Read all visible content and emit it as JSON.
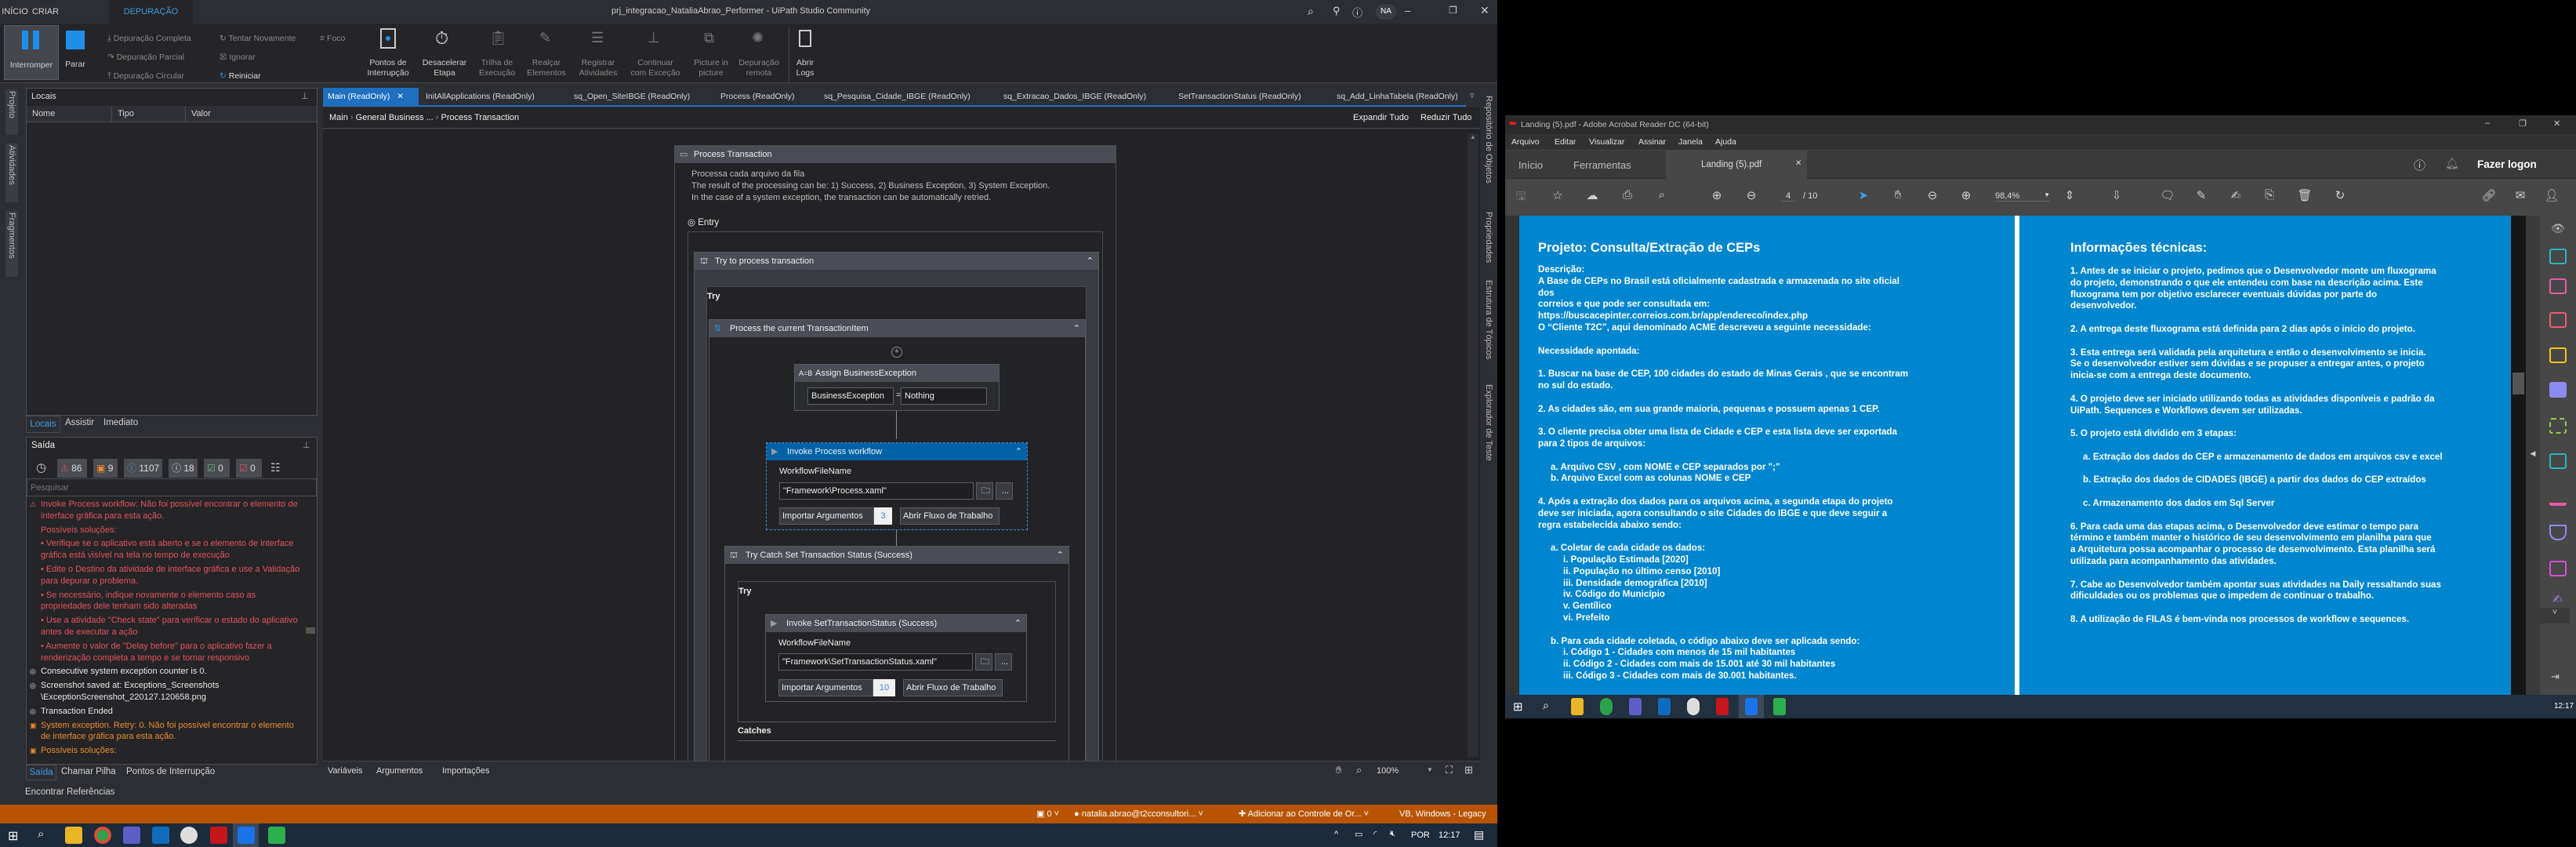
{
  "uipath": {
    "ribbon_tabs": [
      "INÍCIO",
      "CRIAR",
      "DEPURAÇÃO"
    ],
    "window_title": "prj_integracao_NataliaAbrao_Performer - UiPath Studio Community",
    "user_initials": "NA",
    "ribbon": {
      "interromper": "Interromper",
      "parar": "Parar",
      "depuracao_completa": "Depuração Completa",
      "depuracao_parcial": "Depuração Parcial",
      "depuracao_circular": "Depuração Circular",
      "tentar_novamente": "Tentar Novamente",
      "ignorar": "Ignorar",
      "reiniciar": "Reiniciar",
      "foco": "Foco",
      "pontos": [
        "Pontos de",
        "Interrupção"
      ],
      "desacelerar": [
        "Desacelerar",
        "Etapa"
      ],
      "trilha": [
        "Trilha de",
        "Execução"
      ],
      "realcar": [
        "Realçar",
        "Elementos"
      ],
      "registrar": [
        "Registrar",
        "Atividades"
      ],
      "continuar": [
        "Continuar",
        "com Exceção"
      ],
      "picture": [
        "Picture in",
        "picture"
      ],
      "remota": [
        "Depuração",
        "remota"
      ],
      "logs": [
        "Abrir",
        "Logs"
      ]
    },
    "left_strip": [
      "Projeto",
      "Atividades",
      "Fragmentos"
    ],
    "locals": {
      "title": "Locais",
      "columns": [
        "Nome",
        "Tipo",
        "Valor"
      ],
      "tabs": [
        "Locais",
        "Assistir",
        "Imediato"
      ]
    },
    "output": {
      "title": "Saída",
      "filters": {
        "errors": "86",
        "warnings": "9",
        "info": "1107",
        "trace": "18",
        "success": "0",
        "failed": "0"
      },
      "search_placeholder": "Pesquisar",
      "messages": [
        {
          "level": "e",
          "text": "Invoke Process workflow: Não foi possível encontrar o elemento de interface gráfica para esta ação."
        },
        {
          "level": "b",
          "text": "Possíveis soluções:"
        },
        {
          "level": "b",
          "text": "  •  Verifique se o aplicativo está aberto e se o elemento de interface gráfica está visível na tela no tempo de execução"
        },
        {
          "level": "b",
          "text": "  •  Edite o Destino da atividade de interface gráfica e use a Validação para depurar o problema."
        },
        {
          "level": "b",
          "text": "  •  Se necessário, indique novamente o elemento caso as propriedades dele tenham sido alteradas"
        },
        {
          "level": "b",
          "text": "  •  Use a atividade \"Check state\" para verificar o estado do aplicativo antes de executar a ação"
        },
        {
          "level": "b",
          "text": "  •  Aumente o valor de \"Delay before\" para o aplicativo fazer a renderização completa a tempo e se tornar responsivo"
        },
        {
          "level": "i",
          "text": "Consecutive system exception counter is 0."
        },
        {
          "level": "i",
          "text": "Screenshot saved at: Exceptions_Screenshots \\ExceptionScreenshot_220127.120658.png"
        },
        {
          "level": "i",
          "text": "Transaction Ended"
        },
        {
          "level": "w",
          "text": "System exception. Retry: 0. Não foi possível encontrar o elemento de interface gráfica para esta ação."
        },
        {
          "level": "w",
          "text": "Possíveis soluções:"
        }
      ],
      "bottom_tabs": [
        "Saída",
        "Chamar Pilha",
        "Pontos de Interrupção"
      ],
      "find_refs": "Encontrar Referências"
    },
    "doc_tabs": [
      "Main (ReadOnly)",
      "InitAllApplications (ReadOnly)",
      "sq_Open_SiteIBGE (ReadOnly)",
      "Process (ReadOnly)",
      "sq_Pesquisa_Cidade_IBGE (ReadOnly)",
      "sq_Extracao_Dados_IBGE (ReadOnly)",
      "SetTransactionStatus (ReadOnly)",
      "sq_Add_LinhaTabela (ReadOnly)"
    ],
    "breadcrumb": [
      "Main",
      "General Business ...",
      "Process Transaction"
    ],
    "expand_all": "Expandir Tudo",
    "collapse_all": "Reduzir Tudo",
    "designer": {
      "process_title": "Process Transaction",
      "description": [
        "Processa cada arquivo da fila",
        "The result of the processing can be: 1) Success, 2) Business Exception, 3) System Exception.",
        "In the case of a system exception, the transaction can be automatically retried."
      ],
      "entry": "Entry",
      "try_process": "Try to process transaction",
      "try_label": "Try",
      "process_item": "Process the current TransactionItem",
      "assign_title": "Assign BusinessException",
      "assign_to": "BusinessException",
      "assign_value": "Nothing",
      "invoke1": {
        "title": "Invoke Process workflow",
        "label": "WorkflowFileName",
        "file": "\"Framework\\Process.xaml\"",
        "import": "Importar Argumentos",
        "count": "3",
        "open": "Abrir Fluxo de Trabalho"
      },
      "trycatch_title": "Try Catch Set Transaction Status (Success)",
      "invoke2": {
        "title": "Invoke SetTransactionStatus (Success)",
        "label": "WorkflowFileName",
        "file": "\"Framework\\SetTransactionStatus.xaml\"",
        "import": "Importar Argumentos",
        "count": "10",
        "open": "Abrir Fluxo de Trabalho"
      },
      "catches": "Catches"
    },
    "bottom_bar": [
      "Variáveis",
      "Argumentos",
      "Importações"
    ],
    "zoom": "100%",
    "right_panels": [
      "Repositório de Objetos",
      "Propriedades",
      "Estrutura de Tópicos",
      "Explorador de Teste"
    ],
    "status": {
      "git": "0",
      "user": "natalia.abrao@t2cconsultori...",
      "source_control": "Adicionar ao Controle de Or...",
      "lang": "VB, Windows - Legacy"
    },
    "tray": {
      "lang": "POR",
      "time": "12:17"
    }
  },
  "acrobat": {
    "window_title": "Landing (5).pdf - Adobe Acrobat Reader DC (64-bit)",
    "menu": [
      "Arquivo",
      "Editar",
      "Visualizar",
      "Assinar",
      "Janela",
      "Ajuda"
    ],
    "tabs": [
      "Início",
      "Ferramentas",
      "Landing (5).pdf"
    ],
    "sign_in": "Fazer logon",
    "page_current": "4",
    "page_total": "/ 10",
    "zoom": "98,4%",
    "left_title": "Projeto: Consulta/Extração de CEPs",
    "left_lines": [
      {
        "t": "Descrição:",
        "l": 0
      },
      {
        "t": "A Base de CEPs no Brasil está oficialmente cadastrada e armazenada no site oficial",
        "l": 0
      },
      {
        "t": "dos",
        "l": 0
      },
      {
        "t": "correios e que pode ser consultada em:",
        "l": 0
      },
      {
        "t": "https://buscacepinter.correios.com.br/app/endereco/index.php",
        "l": 0
      },
      {
        "t": "O “Cliente T2C”, aqui denominado ACME descreveu a seguinte necessidade:",
        "l": 0
      },
      {
        "t": "",
        "l": 0
      },
      {
        "t": "Necessidade apontada:",
        "l": 0
      },
      {
        "t": "",
        "l": 0
      },
      {
        "t": "1. Buscar na base de CEP, 100 cidades do estado de Minas Gerais , que se encontram",
        "l": 0
      },
      {
        "t": "no sul do estado.",
        "l": 0
      },
      {
        "t": "",
        "l": 0
      },
      {
        "t": "2. As cidades são, em sua grande maioria, pequenas e possuem apenas 1 CEP.",
        "l": 0
      },
      {
        "t": "",
        "l": 0
      },
      {
        "t": "3. O cliente precisa obter uma lista de Cidade e CEP e esta lista deve ser exportada",
        "l": 0
      },
      {
        "t": "para 2 tipos de arquivos:",
        "l": 0
      },
      {
        "t": "",
        "l": 0
      },
      {
        "t": "a. Arquivo CSV , com NOME e CEP separados por \";\"",
        "l": 1
      },
      {
        "t": "b. Arquivo Excel com as colunas NOME e CEP",
        "l": 1
      },
      {
        "t": "",
        "l": 0
      },
      {
        "t": "4. Após a extração dos dados para os arquivos acima, a segunda etapa do projeto",
        "l": 0
      },
      {
        "t": "deve ser iniciada, agora consultando o site Cidades do IBGE e que deve seguir a",
        "l": 0
      },
      {
        "t": "regra estabelecida abaixo sendo:",
        "l": 0
      },
      {
        "t": "",
        "l": 0
      },
      {
        "t": "a. Coletar de cada cidade os dados:",
        "l": 1
      },
      {
        "t": "i. População Estimada [2020]",
        "l": 2
      },
      {
        "t": "ii. População no último censo [2010]",
        "l": 2
      },
      {
        "t": "iii. Densidade demográfica [2010]",
        "l": 2
      },
      {
        "t": "iv. Código do Município",
        "l": 2
      },
      {
        "t": "v. Gentílico",
        "l": 2
      },
      {
        "t": "vi. Prefeito",
        "l": 2
      },
      {
        "t": "",
        "l": 0
      },
      {
        "t": "b. Para cada cidade coletada, o código abaixo deve ser aplicada sendo:",
        "l": 1
      },
      {
        "t": "i. Código 1 - Cidades com menos de 15 mil habitantes",
        "l": 2
      },
      {
        "t": "ii. Código 2 - Cidades com mais de 15.001 até 30 mil habitantes",
        "l": 2
      },
      {
        "t": "iii. Código 3 - Cidades com mais de 30.001 habitantes.",
        "l": 2
      }
    ],
    "right_title": "Informações técnicas:",
    "right_lines": [
      {
        "t": "1. Antes de se iniciar o projeto, pedimos que o Desenvolvedor monte um fluxograma",
        "l": 0
      },
      {
        "t": "do projeto, demonstrando o que ele entendeu com base na descrição acima. Este",
        "l": 0
      },
      {
        "t": "fluxograma tem por objetivo esclarecer eventuais dúvidas por parte do",
        "l": 0
      },
      {
        "t": "desenvolvedor.",
        "l": 0
      },
      {
        "t": "",
        "l": 0
      },
      {
        "t": "2. A entrega deste fluxograma está definida para 2 dias após o início do projeto.",
        "l": 0
      },
      {
        "t": "",
        "l": 0
      },
      {
        "t": "3. Esta entrega será validada pela arquitetura e então o desenvolvimento se inicia.",
        "l": 0
      },
      {
        "t": "Se o desenvolvedor estiver sem dúvidas e se propuser a entregar antes, o projeto",
        "l": 0
      },
      {
        "t": "inicia-se com a entrega deste documento.",
        "l": 0
      },
      {
        "t": "",
        "l": 0
      },
      {
        "t": "4. O projeto deve ser iniciado utilizando todas as atividades disponíveis e padrão da",
        "l": 0
      },
      {
        "t": "UiPath. Sequences e Workflows devem ser utilizadas.",
        "l": 0
      },
      {
        "t": "",
        "l": 0
      },
      {
        "t": "5. O projeto está dividido em 3 etapas:",
        "l": 0
      },
      {
        "t": "",
        "l": 0
      },
      {
        "t": "a. Extração dos dados do CEP e armazenamento de dados em arquivos csv e excel",
        "l": 1
      },
      {
        "t": "",
        "l": 0
      },
      {
        "t": "b. Extração dos dados de CIDADES (IBGE) a partir dos dados do CEP extraídos",
        "l": 1
      },
      {
        "t": "",
        "l": 0
      },
      {
        "t": "c. Armazenamento dos dados em Sql Server",
        "l": 1
      },
      {
        "t": "",
        "l": 0
      },
      {
        "t": "6. Para cada uma das etapas acima, o Desenvolvedor deve estimar o tempo para",
        "l": 0
      },
      {
        "t": "término e também manter o histórico de seu desenvolvimento em planilha para que",
        "l": 0
      },
      {
        "t": "a Arquitetura possa acompanhar o processo de desenvolvimento. Esta planilha será",
        "l": 0
      },
      {
        "t": "utilizada para acompanhamento das atividades.",
        "l": 0
      },
      {
        "t": "",
        "l": 0
      },
      {
        "t": "7. Cabe ao Desenvolvedor também apontar suas atividades na Daily ressaltando suas",
        "l": 0
      },
      {
        "t": "dificuldades ou os problemas que o impedem de continuar o trabalho.",
        "l": 0
      },
      {
        "t": "",
        "l": 0
      },
      {
        "t": "8. A utilização de FILAS é bem-vinda nos processos de workflow e sequences.",
        "l": 0
      }
    ],
    "taskbar_time": "12:17"
  },
  "colors": {
    "pdf_blue": "#0086CE",
    "uipath_accent": "#1e6fbf",
    "status_orange": "#b85400",
    "error_red": "#e5535a",
    "warn_orange": "#ec8a2b"
  }
}
